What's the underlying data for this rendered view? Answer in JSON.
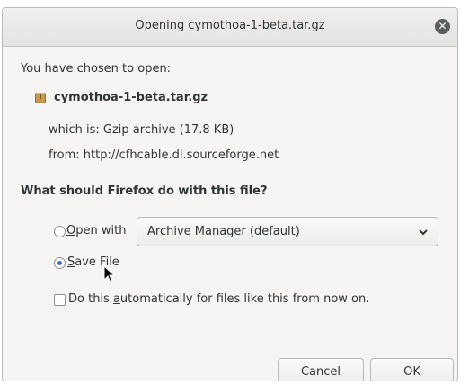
{
  "dialog": {
    "title": "Opening cymothoa-1-beta.tar.gz",
    "intro": "You have chosen to open:",
    "file_name": "cymothoa-1-beta.tar.gz",
    "which_is": "which is: Gzip archive (17.8 KB)",
    "from": "from: http://cfhcable.dl.sourceforge.net",
    "question": "What should Firefox do with this file?",
    "open_with_label_first": "O",
    "open_with_label_rest": "pen with",
    "open_with_app": "Archive Manager (default)",
    "save_file_label_first": "S",
    "save_file_label_rest": "ave File",
    "auto_label_pre": "Do this ",
    "auto_label_underline": "a",
    "auto_label_post": "utomatically for files like this from now on.",
    "cancel_label": "Cancel",
    "ok_label": "OK",
    "selected_option": "save-file",
    "auto_checked": false
  },
  "icons": {
    "close": "close-icon",
    "file": "archive-file-icon",
    "dropdown": "chevron-down-icon",
    "pointer": "mouse-pointer-icon"
  },
  "colors": {
    "accent": "#3b6ed6",
    "window_bg": "#f6f5f4"
  }
}
